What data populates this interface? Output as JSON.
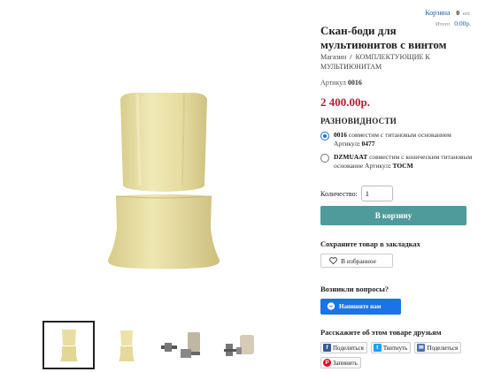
{
  "cart": {
    "label": "Корзина",
    "count": "0",
    "unit": "шт.",
    "total_label": "Итого",
    "total_value": "0.00р."
  },
  "product": {
    "title": "Скан-боди для мультиюнитов с винтом",
    "breadcrumb": [
      "Магазин",
      "КОМПЛЕКТУЮЩИЕ К МУЛЬТИЮНИТАМ"
    ],
    "sku_label": "Артикул",
    "sku": "0016",
    "price": "2 400.00р."
  },
  "variants": {
    "title": "РАЗНОВИДНОСТИ",
    "items": [
      {
        "code": "0016",
        "text": " совместим с титановым основанием Артикул",
        "article": "0477",
        "selected": true
      },
      {
        "code": "DZMUAAT",
        "text": " совместим с коническим титановым основание Артикул",
        "article": "TOCM",
        "selected": false
      }
    ]
  },
  "quantity": {
    "label": "Количество:",
    "value": "1"
  },
  "add_to_cart": "В корзину",
  "bookmark": {
    "title": "Сохраните товар в закладках",
    "button": "В избранное"
  },
  "questions": {
    "title": "Возникли вопросы?",
    "button": "Напишите нам"
  },
  "share": {
    "title": "Расскажите об этом товаре друзьям",
    "facebook": "Поделиться",
    "twitter": "Твитнуть",
    "email": "Поделиться",
    "pinterest": "Запинить"
  },
  "colors": {
    "price": "#b31e2e",
    "accent_button": "#4f9b9c",
    "messenger": "#1a73e8",
    "product_body": "#e9e0a6"
  },
  "icons": [
    "heart-icon",
    "messenger-icon",
    "facebook-icon",
    "twitter-icon",
    "email-icon",
    "pinterest-icon"
  ]
}
